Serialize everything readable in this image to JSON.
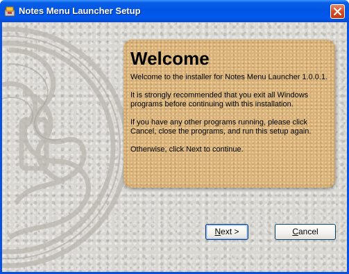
{
  "window": {
    "title": "Notes Menu Launcher Setup",
    "app_icon": "installer-app-icon",
    "close_icon": "close-icon"
  },
  "panel": {
    "heading": "Welcome",
    "paragraphs": [
      "Welcome to the installer for Notes Menu Launcher 1.0.0.1.",
      "It is strongly recommended that you exit all Windows programs before continuing with this installation.",
      "If you have any other programs running, please click Cancel, close the programs, and run this setup again.",
      "Otherwise, click Next to continue."
    ]
  },
  "buttons": {
    "next_mnemonic": "N",
    "next_rest": "ext >",
    "cancel_mnemonic": "C",
    "cancel_rest": "ancel"
  },
  "colors": {
    "titlebar": "#0054e3",
    "panel": "#d8b27a",
    "background": "#d9d7d2"
  }
}
